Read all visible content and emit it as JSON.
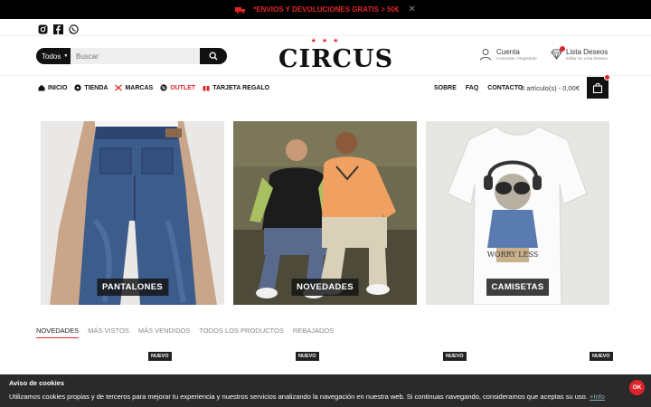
{
  "promo": {
    "text": "*ENVIOS Y DEVOLUCIONES GRATIS > 50€",
    "close": "✕"
  },
  "search": {
    "category": "Todos",
    "placeholder": "Buscar"
  },
  "logo": {
    "stars": "★ ★ ★",
    "word": "CIRCUS"
  },
  "account": {
    "title": "Cuenta",
    "subtitle": "Conectate / Registrate"
  },
  "wishlist": {
    "title": "Lista Deseos",
    "subtitle": "Editar Su Lista Deseos"
  },
  "nav": {
    "items": [
      "INICIO",
      "TIENDA",
      "MARCAS",
      "OUTLET",
      "TARJETA REGALO"
    ],
    "right": [
      "SOBRE",
      "FAQ",
      "CONTACTO"
    ]
  },
  "cart": {
    "text": "0 artículo(s) - 0,00€"
  },
  "tiles": [
    {
      "label": "PANTALONES"
    },
    {
      "label": "NOVEDADES"
    },
    {
      "label": "CAMISETAS"
    }
  ],
  "product_tabs": [
    "NOVEDADES",
    "MÁS VISTOS",
    "MÁS VENDIDOS",
    "TODOS LOS PRODUCTOS",
    "REBAJADOS"
  ],
  "badge": "NUEVO",
  "cookie": {
    "title": "Aviso de cookies",
    "text": "Utilizamos cookies propias y de terceros para mejorar tu experiencia y nuestros servicios analizando la navegación en nuestra web. Si continuas navegando, consideramos que aceptas su uso.",
    "more": "+Info",
    "ok": "OK"
  },
  "colors": {
    "accent": "#e0242a",
    "dark": "#111111"
  }
}
